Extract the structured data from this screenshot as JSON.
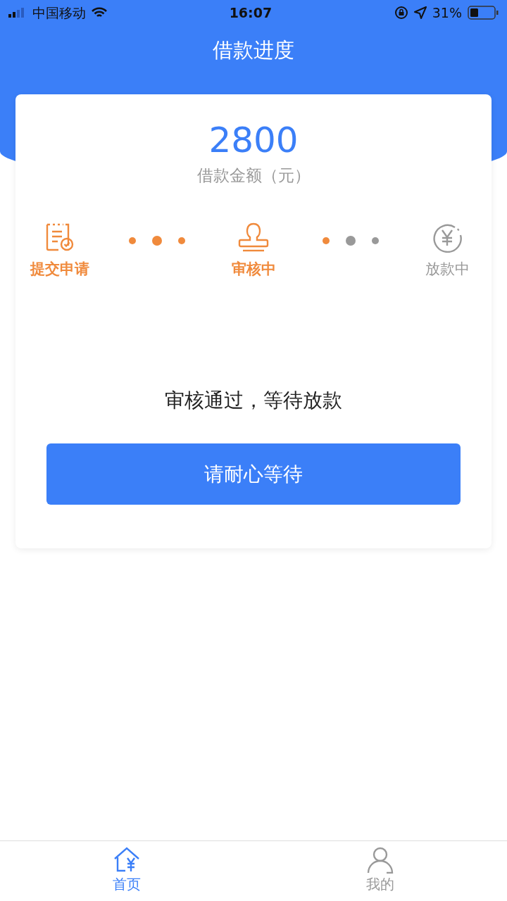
{
  "status_bar": {
    "carrier": "中国移动",
    "time": "16:07",
    "battery": "31%"
  },
  "title": "借款进度",
  "loan": {
    "amount": "2800",
    "amount_label": "借款金额（元）"
  },
  "steps": [
    {
      "label": "提交申请",
      "kind": "form",
      "active": true
    },
    {
      "label": "审核中",
      "kind": "stamp",
      "active": true
    },
    {
      "label": "放款中",
      "kind": "money",
      "active": false
    }
  ],
  "message": "审核通过，等待放款",
  "action_button": {
    "label": "请耐心等待"
  },
  "tabs": [
    {
      "label": "首页",
      "kind": "home",
      "selected": true
    },
    {
      "label": "我的",
      "kind": "profile",
      "selected": false
    }
  ]
}
